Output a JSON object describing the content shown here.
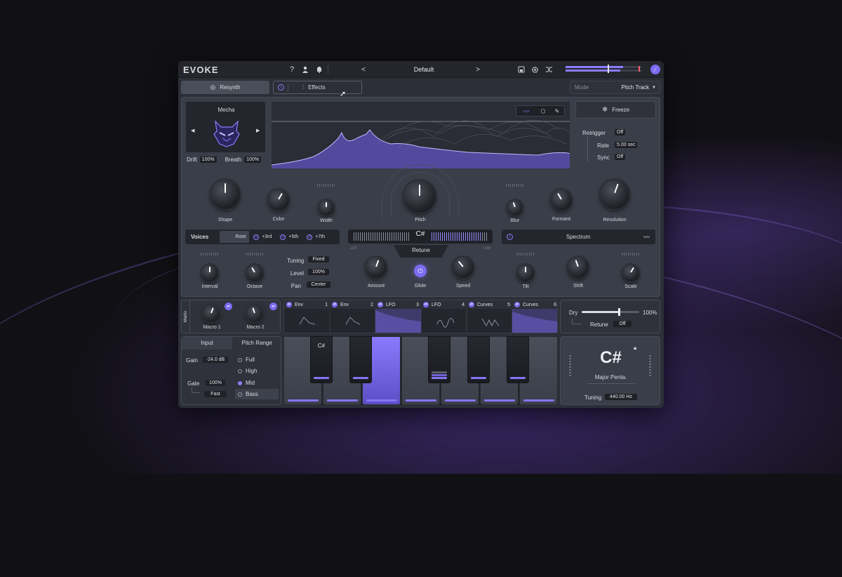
{
  "app": {
    "title": "EVOKE",
    "preset": "Default",
    "prev": "<",
    "next": ">"
  },
  "top_icons": {
    "help": "?"
  },
  "tabs": {
    "resynth": "Resynth",
    "effects": "Effects"
  },
  "mode": {
    "label": "Mode",
    "value": "Pitch Track"
  },
  "source": {
    "name": "Mecha",
    "drift_label": "Drift",
    "drift": "100%",
    "breath_label": "Breath",
    "breath": "100%"
  },
  "freeze": {
    "label": "Freeze",
    "retrigger_label": "Retrigger",
    "retrigger": "Off",
    "rate_label": "Rate",
    "rate": "5.00 sec",
    "sync_label": "Sync",
    "sync": "Off"
  },
  "knobs_top": {
    "shape": "Shape",
    "color": "Color",
    "width": "Width",
    "pitch": "Pitch",
    "blur": "Blur",
    "formant": "Formant",
    "resolution": "Resolution"
  },
  "voices": {
    "title": "Voices",
    "root": "Root",
    "third": "+3rd",
    "fifth": "+5th",
    "seventh": "+7th",
    "interval": "Interval",
    "octave": "Octave",
    "tuning_label": "Tuning",
    "tuning": "Fixed",
    "level_label": "Level",
    "level": "100%",
    "pan_label": "Pan",
    "pan": "Center"
  },
  "retune": {
    "note": "C#",
    "title": "Retune",
    "min": "-100",
    "max": "+100",
    "amount": "Amount",
    "glide": "Glide",
    "speed": "Speed"
  },
  "spectrum": {
    "title": "Spectrum",
    "tilt": "Tilt",
    "shift": "Shift",
    "scale": "Scale"
  },
  "matrix": {
    "title": "Matrix",
    "macro1": "Macro 1",
    "macro2": "Macro 2",
    "slots": [
      {
        "name": "Env",
        "num": "1"
      },
      {
        "name": "Env",
        "num": "2"
      },
      {
        "name": "LFO",
        "num": "3"
      },
      {
        "name": "LFO",
        "num": "4"
      },
      {
        "name": "Curves",
        "num": "5"
      },
      {
        "name": "Curves",
        "num": "6"
      }
    ]
  },
  "dry": {
    "label": "Dry",
    "value": "100%",
    "retune_label": "Retune",
    "retune": "Off",
    "level": 0.65
  },
  "input": {
    "title": "Input",
    "gain_label": "Gain",
    "gain": "-24.0 dB",
    "gate_label": "Gate",
    "gate": "100%",
    "speed": "Fast"
  },
  "pitch_range": {
    "title": "Pitch Range",
    "full": "Full",
    "high": "High",
    "mid": "Mid",
    "bass": "Bass"
  },
  "keys": {
    "note": "C#"
  },
  "scale": {
    "note": "C#",
    "name": "Major Penta.",
    "tuning_label": "Tuning",
    "tuning": "440.00 Hz"
  },
  "colors": {
    "accent": "#7b6cf0",
    "bg": "#2c2f37"
  }
}
